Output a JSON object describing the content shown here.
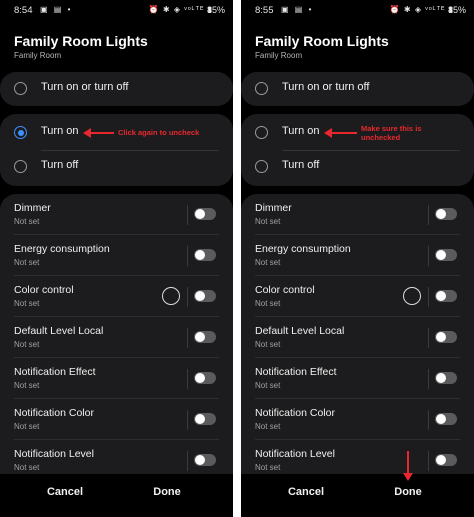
{
  "screens": [
    {
      "status": {
        "time": "8:54",
        "battery": "85%",
        "left_icons": "▣ ▤ •",
        "right_icons": "⏰ ✱ ◈ ᵛᵒᴸᵀᴱ ▮"
      },
      "title": "Family Room Lights",
      "subtitle": "Family Room",
      "top_option": "Turn on or turn off",
      "options": [
        {
          "label": "Turn on",
          "checked": true
        },
        {
          "label": "Turn off",
          "checked": false
        }
      ],
      "annotation": "Click again to uncheck",
      "settings": [
        {
          "name": "Dimmer",
          "value": "Not set"
        },
        {
          "name": "Energy consumption",
          "value": "Not set"
        },
        {
          "name": "Color control",
          "value": "Not set"
        },
        {
          "name": "Default Level Local",
          "value": "Not set"
        },
        {
          "name": "Notification Effect",
          "value": "Not set"
        },
        {
          "name": "Notification Color",
          "value": "Not set"
        },
        {
          "name": "Notification Level",
          "value": "Not set"
        }
      ],
      "cancel_label": "Cancel",
      "done_label": "Done"
    },
    {
      "status": {
        "time": "8:55",
        "battery": "85%",
        "left_icons": "▣ ▤ •",
        "right_icons": "⏰ ✱ ◈ ᵛᵒᴸᵀᴱ ▮"
      },
      "title": "Family Room Lights",
      "subtitle": "Family Room",
      "top_option": "Turn on or turn off",
      "options": [
        {
          "label": "Turn on",
          "checked": false
        },
        {
          "label": "Turn off",
          "checked": false
        }
      ],
      "annotation": "Make sure this is unchecked",
      "settings": [
        {
          "name": "Dimmer",
          "value": "Not set"
        },
        {
          "name": "Energy consumption",
          "value": "Not set"
        },
        {
          "name": "Color control",
          "value": "Not set"
        },
        {
          "name": "Default Level Local",
          "value": "Not set"
        },
        {
          "name": "Notification Effect",
          "value": "Not set"
        },
        {
          "name": "Notification Color",
          "value": "Not set"
        },
        {
          "name": "Notification Level",
          "value": "Not set"
        }
      ],
      "cancel_label": "Cancel",
      "done_label": "Done"
    }
  ],
  "colors": {
    "accent": "#3e91ff",
    "annotation": "#e8282e",
    "card": "#1c1c1e",
    "background": "#000000"
  },
  "icons": [
    "signal-icon",
    "wifi-icon",
    "alarm-icon",
    "bluetooth-icon",
    "battery-icon",
    "radio-icon",
    "toggle-icon",
    "color-circle-icon",
    "arrow-icon"
  ]
}
